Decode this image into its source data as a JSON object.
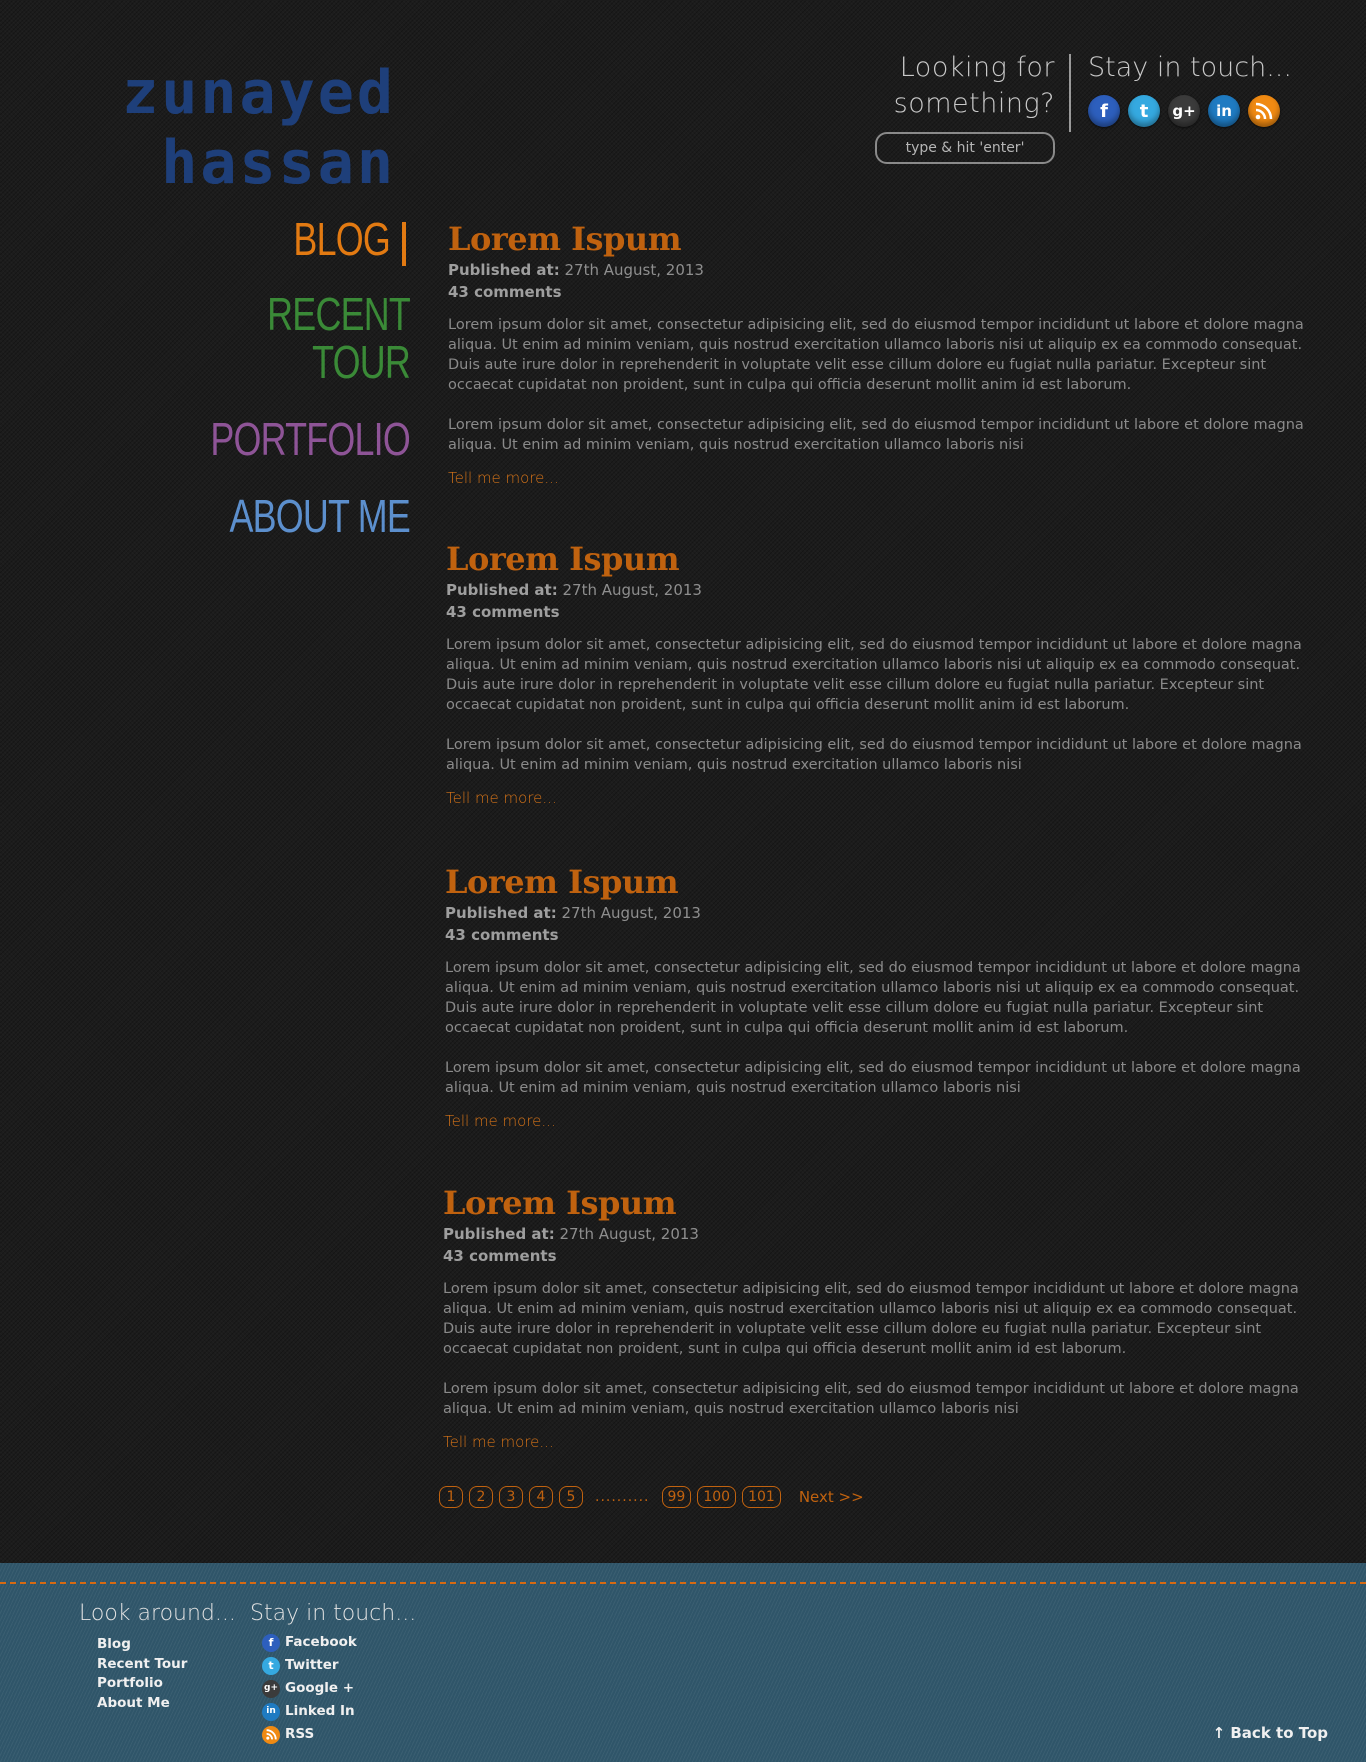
{
  "logo": {
    "line1": "zunayed",
    "line2": "hassan"
  },
  "search": {
    "title": "Looking for something?",
    "placeholder": "type & hit 'enter'"
  },
  "header_touch": {
    "title": "Stay in touch..."
  },
  "social_icons": [
    "facebook-icon",
    "twitter-icon",
    "google-plus-icon",
    "linkedin-icon",
    "rss-icon"
  ],
  "nav": {
    "items": [
      {
        "label": "BLOG",
        "color": "#e27a12"
      },
      {
        "label": "RECENT TOUR",
        "color": "#3a8a37"
      },
      {
        "label": "PORTFOLIO",
        "color": "#8e5497"
      },
      {
        "label": "ABOUT ME",
        "color": "#5c8fcd"
      }
    ]
  },
  "posts": [
    {
      "title": "Lorem Ispum",
      "published_label": "Published at:",
      "published_date": "27th August, 2013",
      "comments": "43 comments",
      "para1": "Lorem ipsum dolor sit amet, consectetur adipisicing elit, sed do eiusmod tempor incididunt ut labore et dolore magna aliqua. Ut enim ad minim veniam, quis nostrud exercitation ullamco laboris nisi ut aliquip ex ea commodo consequat. Duis aute irure dolor in reprehenderit in voluptate velit esse cillum dolore eu fugiat nulla pariatur. Excepteur sint occaecat cupidatat non proident, sunt in culpa qui officia deserunt mollit anim id est laborum.",
      "para2": "Lorem ipsum dolor sit amet, consectetur adipisicing elit, sed do eiusmod tempor incididunt ut labore et dolore magna aliqua. Ut enim ad minim veniam, quis nostrud exercitation ullamco laboris nisi",
      "more": "Tell me more..."
    },
    {
      "title": "Lorem Ispum",
      "published_label": "Published at:",
      "published_date": "27th August, 2013",
      "comments": "43 comments",
      "para1": "Lorem ipsum dolor sit amet, consectetur adipisicing elit, sed do eiusmod tempor incididunt ut labore et dolore magna aliqua. Ut enim ad minim veniam, quis nostrud exercitation ullamco laboris nisi ut aliquip ex ea commodo consequat. Duis aute irure dolor in reprehenderit in voluptate velit esse cillum dolore eu fugiat nulla pariatur. Excepteur sint occaecat cupidatat non proident, sunt in culpa qui officia deserunt mollit anim id est laborum.",
      "para2": "Lorem ipsum dolor sit amet, consectetur adipisicing elit, sed do eiusmod tempor incididunt ut labore et dolore magna aliqua. Ut enim ad minim veniam, quis nostrud exercitation ullamco laboris nisi",
      "more": "Tell me more..."
    },
    {
      "title": "Lorem Ispum",
      "published_label": "Published at:",
      "published_date": "27th August, 2013",
      "comments": "43 comments",
      "para1": "Lorem ipsum dolor sit amet, consectetur adipisicing elit, sed do eiusmod tempor incididunt ut labore et dolore magna aliqua. Ut enim ad minim veniam, quis nostrud exercitation ullamco laboris nisi ut aliquip ex ea commodo consequat. Duis aute irure dolor in reprehenderit in voluptate velit esse cillum dolore eu fugiat nulla pariatur. Excepteur sint occaecat cupidatat non proident, sunt in culpa qui officia deserunt mollit anim id est laborum.",
      "para2": "Lorem ipsum dolor sit amet, consectetur adipisicing elit, sed do eiusmod tempor incididunt ut labore et dolore magna aliqua. Ut enim ad minim veniam, quis nostrud exercitation ullamco laboris nisi",
      "more": "Tell me more..."
    },
    {
      "title": "Lorem Ispum",
      "published_label": "Published at:",
      "published_date": "27th August, 2013",
      "comments": "43 comments",
      "para1": "Lorem ipsum dolor sit amet, consectetur adipisicing elit, sed do eiusmod tempor incididunt ut labore et dolore magna aliqua. Ut enim ad minim veniam, quis nostrud exercitation ullamco laboris nisi ut aliquip ex ea commodo consequat. Duis aute irure dolor in reprehenderit in voluptate velit esse cillum dolore eu fugiat nulla pariatur. Excepteur sint occaecat cupidatat non proident, sunt in culpa qui officia deserunt mollit anim id est laborum.",
      "para2": "Lorem ipsum dolor sit amet, consectetur adipisicing elit, sed do eiusmod tempor incididunt ut labore et dolore magna aliqua. Ut enim ad minim veniam, quis nostrud exercitation ullamco laboris nisi",
      "more": "Tell me more..."
    }
  ],
  "pagination": {
    "pages_start": [
      "1",
      "2",
      "3",
      "4",
      "5"
    ],
    "dots": "..........",
    "pages_end": [
      "99",
      "100",
      "101"
    ],
    "next": "Next >>"
  },
  "footer": {
    "look_title": "Look around...",
    "look_links": [
      "Blog",
      "Recent Tour",
      "Portfolio",
      "About Me"
    ],
    "touch_title": "Stay in touch...",
    "touch_links": [
      {
        "label": "Facebook",
        "icon": "facebook-icon"
      },
      {
        "label": "Twitter",
        "icon": "twitter-icon"
      },
      {
        "label": "Google +",
        "icon": "google-plus-icon"
      },
      {
        "label": "Linked In",
        "icon": "linkedin-icon"
      },
      {
        "label": "RSS",
        "icon": "rss-icon"
      }
    ],
    "back_to_top": "Back to Top",
    "back_icon": "arrow-up-icon"
  },
  "colors": {
    "accent": "#c0620f",
    "logo": "#1e3f7a",
    "footer_bg": "#2f5569",
    "stitch": "#d86a12"
  }
}
